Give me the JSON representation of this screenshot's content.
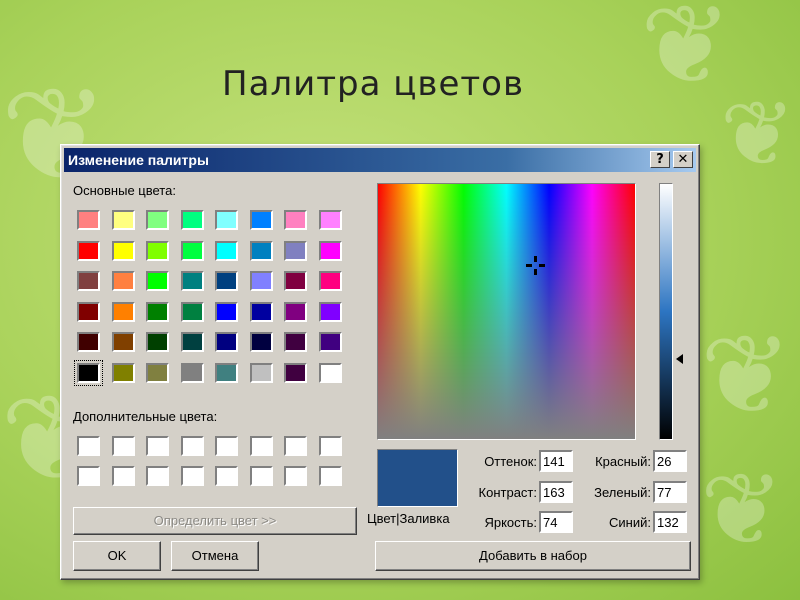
{
  "slide_title": "Палитра цветов",
  "dialog": {
    "title": "Изменение палитры",
    "help_label": "?",
    "close_label": "✕",
    "basic_colors_label": "Основные цвета:",
    "basic_colors": [
      [
        "#ff8080",
        "#ffff80",
        "#80ff80",
        "#00ff80",
        "#80ffff",
        "#0080ff",
        "#ff80c0",
        "#ff80ff"
      ],
      [
        "#ff0000",
        "#ffff00",
        "#80ff00",
        "#00ff40",
        "#00ffff",
        "#0080c0",
        "#8080c0",
        "#ff00ff"
      ],
      [
        "#804040",
        "#ff8040",
        "#00ff00",
        "#008080",
        "#004080",
        "#8080ff",
        "#800040",
        "#ff0080"
      ],
      [
        "#800000",
        "#ff8000",
        "#008000",
        "#008040",
        "#0000ff",
        "#0000a0",
        "#800080",
        "#8000ff"
      ],
      [
        "#400000",
        "#804000",
        "#004000",
        "#004040",
        "#000080",
        "#000040",
        "#400040",
        "#400080"
      ],
      [
        "#000000",
        "#808000",
        "#808040",
        "#808080",
        "#408080",
        "#c0c0c0",
        "#400040",
        "#ffffff"
      ]
    ],
    "custom_colors_label": "Дополнительные цвета:",
    "define_button": "Определить цвет >>",
    "ok_button": "OK",
    "cancel_button": "Отмена",
    "preview_color": "#22508a",
    "preview_label": "Цвет|Заливка",
    "fields": {
      "hue_label": "Оттенок:",
      "hue": "141",
      "sat_label": "Контраст:",
      "sat": "163",
      "lum_label": "Яркость:",
      "lum": "74",
      "red_label": "Красный:",
      "red": "26",
      "green_label": "Зеленый:",
      "green": "77",
      "blue_label": "Синий:",
      "blue": "132"
    },
    "add_button": "Добавить в набор"
  }
}
